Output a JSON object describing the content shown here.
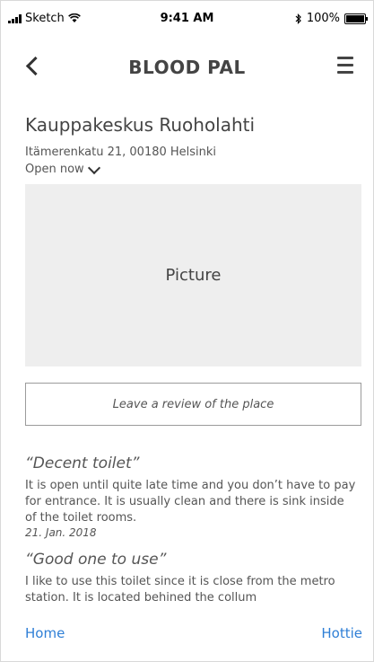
{
  "status_bar": {
    "carrier": "Sketch",
    "time": "9:41 AM",
    "battery": "100%"
  },
  "nav": {
    "title": "BLOOD PAL"
  },
  "place": {
    "name": "Kauppakeskus Ruoholahti",
    "address": "Itämerenkatu 21, 00180 Helsinki",
    "open_status": "Open now",
    "picture_label": "Picture"
  },
  "review_button": {
    "label": "Leave a review of the place"
  },
  "reviews": [
    {
      "title": "“Decent toilet”",
      "body": "It is open until quite late time and you don’t have to pay for entrance. It is usually clean and there is sink inside of the toilet rooms.",
      "date": "21. Jan. 2018"
    },
    {
      "title": "“Good one to use”",
      "body": "I like to use this toilet since it is close from the metro station. It is located behined the collum"
    }
  ],
  "tabs": {
    "home": "Home",
    "hottie": "Hottie"
  },
  "colors": {
    "accent": "#2f7fd6",
    "picture_bg": "#eeeeee",
    "text": "#555555"
  }
}
